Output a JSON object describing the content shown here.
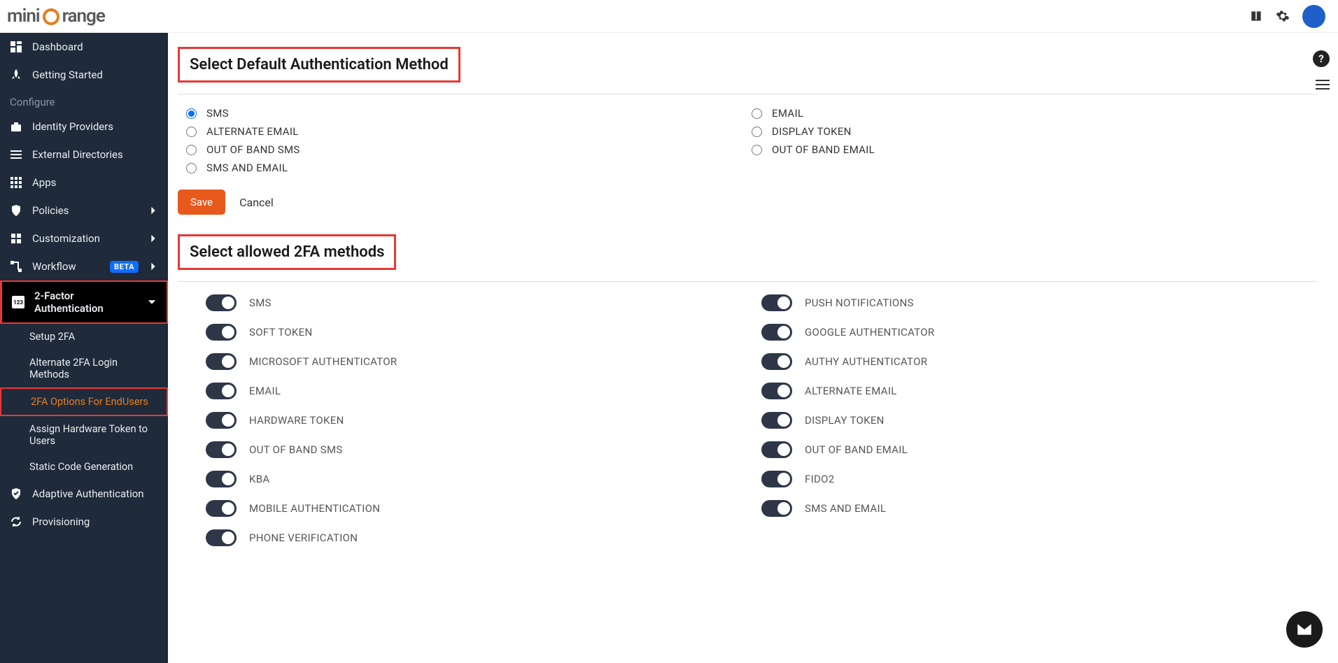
{
  "logo_text": "miniOrange",
  "sidebar": {
    "items": [
      {
        "label": "Dashboard",
        "icon": "dashboard"
      },
      {
        "label": "Getting Started",
        "icon": "rocket"
      }
    ],
    "section_label": "Configure",
    "configure_items": [
      {
        "label": "Identity Providers",
        "icon": "briefcase"
      },
      {
        "label": "External Directories",
        "icon": "list"
      },
      {
        "label": "Apps",
        "icon": "grid"
      },
      {
        "label": "Policies",
        "icon": "shield",
        "chevron": true
      },
      {
        "label": "Customization",
        "icon": "puzzle",
        "chevron": true
      },
      {
        "label": "Workflow",
        "icon": "flow",
        "badge": "BETA",
        "chevron": true
      },
      {
        "label": "2-Factor Authentication",
        "icon": "2fa",
        "chevron": true,
        "active": true
      },
      {
        "label": "Adaptive Authentication",
        "icon": "check-shield"
      },
      {
        "label": "Provisioning",
        "icon": "cycle"
      }
    ],
    "sub_2fa": [
      {
        "label": "Setup 2FA"
      },
      {
        "label": "Alternate 2FA Login Methods"
      },
      {
        "label": "2FA Options For EndUsers",
        "active": true
      },
      {
        "label": "Assign Hardware Token to Users"
      },
      {
        "label": "Static Code Generation"
      }
    ]
  },
  "main": {
    "heading1": "Select Default Authentication Method",
    "radio_left": [
      {
        "label": "SMS",
        "checked": true
      },
      {
        "label": "ALTERNATE EMAIL",
        "checked": false
      },
      {
        "label": "OUT OF BAND SMS",
        "checked": false
      },
      {
        "label": "SMS AND EMAIL",
        "checked": false
      }
    ],
    "radio_right": [
      {
        "label": "EMAIL",
        "checked": false
      },
      {
        "label": "DISPLAY TOKEN",
        "checked": false
      },
      {
        "label": "OUT OF BAND EMAIL",
        "checked": false
      }
    ],
    "save_label": "Save",
    "cancel_label": "Cancel",
    "heading2": "Select allowed 2FA methods",
    "toggles_left": [
      {
        "label": "SMS",
        "on": true
      },
      {
        "label": "SOFT TOKEN",
        "on": true
      },
      {
        "label": "MICROSOFT AUTHENTICATOR",
        "on": true
      },
      {
        "label": "EMAIL",
        "on": true
      },
      {
        "label": "HARDWARE TOKEN",
        "on": true
      },
      {
        "label": "OUT OF BAND SMS",
        "on": true
      },
      {
        "label": "KBA",
        "on": true
      },
      {
        "label": "MOBILE AUTHENTICATION",
        "on": true
      },
      {
        "label": "PHONE VERIFICATION",
        "on": true
      }
    ],
    "toggles_right": [
      {
        "label": "PUSH NOTIFICATIONS",
        "on": true
      },
      {
        "label": "GOOGLE AUTHENTICATOR",
        "on": true
      },
      {
        "label": "AUTHY AUTHENTICATOR",
        "on": true
      },
      {
        "label": "ALTERNATE EMAIL",
        "on": true
      },
      {
        "label": "DISPLAY TOKEN",
        "on": true
      },
      {
        "label": "OUT OF BAND EMAIL",
        "on": true
      },
      {
        "label": "FIDO2",
        "on": true
      },
      {
        "label": "SMS AND EMAIL",
        "on": true
      }
    ]
  }
}
